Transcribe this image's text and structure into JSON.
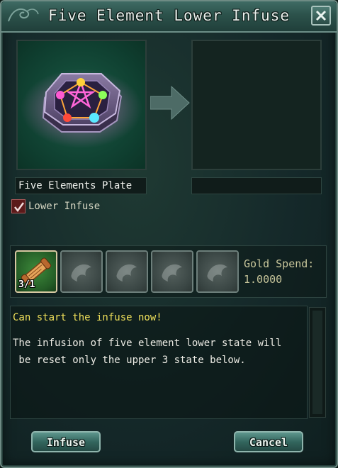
{
  "window": {
    "title": "Five Element Lower Infuse"
  },
  "source_item": {
    "name": "Five Elements Plate",
    "icon": "five-elements-plate-icon"
  },
  "target_item": {
    "name": ""
  },
  "options": {
    "lower_infuse_label": "Lower Infuse",
    "lower_infuse_checked": true
  },
  "materials": {
    "slots": [
      {
        "icon": "scroll-icon",
        "count": "3/1",
        "filled": true
      },
      {
        "icon": "empty-slot-icon",
        "count": "",
        "filled": false
      },
      {
        "icon": "empty-slot-icon",
        "count": "",
        "filled": false
      },
      {
        "icon": "empty-slot-icon",
        "count": "",
        "filled": false
      },
      {
        "icon": "empty-slot-icon",
        "count": "",
        "filled": false
      }
    ],
    "gold_label": "Gold Spend:",
    "gold_value": "1.0000"
  },
  "info": {
    "status": "Can start the infuse now!",
    "description": "The infusion of five element lower state will\n be reset only the upper 3 state below."
  },
  "buttons": {
    "infuse": "Infuse",
    "cancel": "Cancel"
  },
  "colors": {
    "status_text": "#f0e05a",
    "panel_bg": "#15292a",
    "title_bar": "#2c524b"
  }
}
